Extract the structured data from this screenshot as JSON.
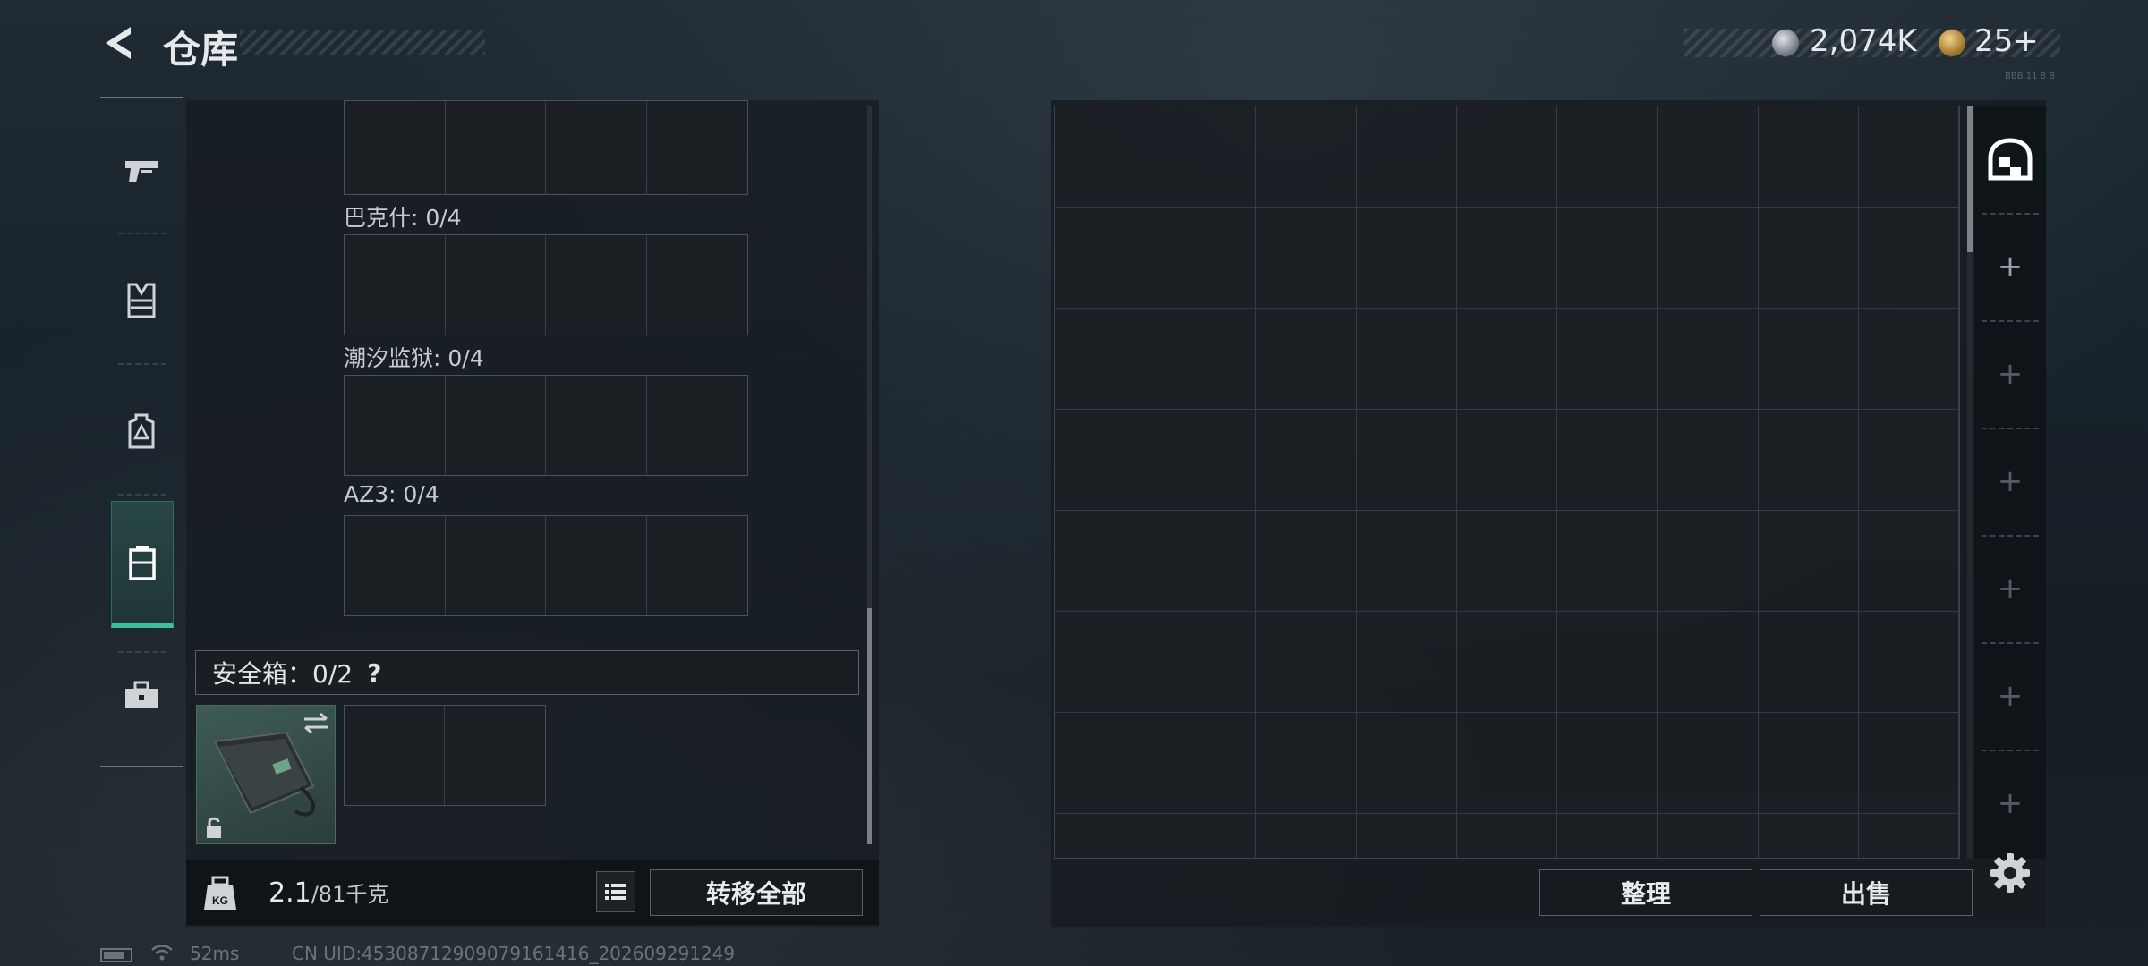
{
  "header": {
    "title": "仓库",
    "currency_1": "2,074K",
    "currency_2": "25+",
    "small_code": "BBB  11 8 B"
  },
  "sidebar": {
    "items": [
      {
        "name": "weapon",
        "icon": "pistol-icon",
        "active": false
      },
      {
        "name": "armor",
        "icon": "vest-icon",
        "active": false
      },
      {
        "name": "backpack",
        "icon": "backpack-icon",
        "active": false
      },
      {
        "name": "container",
        "icon": "case-icon",
        "active": true
      },
      {
        "name": "toolbox",
        "icon": "toolbox-icon",
        "active": false
      }
    ]
  },
  "loadout": {
    "grids": [
      {
        "label": ""
      },
      {
        "label": "巴克什: 0/4"
      },
      {
        "label": "潮汐监狱: 0/4"
      },
      {
        "label": "AZ3: 0/4"
      }
    ],
    "safe_box": {
      "label": "安全箱：0/2",
      "help": "?",
      "icons": [
        "swap-icon",
        "lock-icon"
      ]
    },
    "weight_value": "2.1",
    "weight_capacity": "/81千克",
    "transfer_all": "转移全部"
  },
  "storage": {
    "columns": 9,
    "rows_visible": 8,
    "sort_label": "整理",
    "sell_label": "出售",
    "side_tabs": [
      "home-icon",
      "+",
      "+",
      "+",
      "+",
      "+",
      "+"
    ]
  },
  "status": {
    "ping": "52ms",
    "uid": "CN UID:453087129090791614​16_202609291249"
  },
  "colors": {
    "accent": "#3fbf98",
    "panel": "#171d22"
  }
}
